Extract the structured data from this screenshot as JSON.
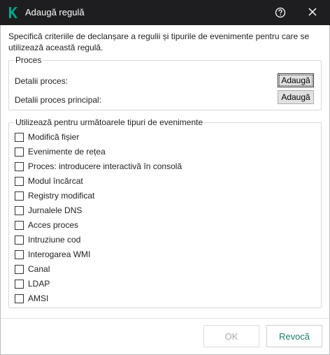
{
  "window": {
    "title": "Adaugă regulă"
  },
  "description": "Specifică criteriile de declanșare a regulii și tipurile de evenimente pentru care se utilizează această regulă.",
  "process_group": {
    "legend": "Proces",
    "rows": [
      {
        "label": "Detalii proces:",
        "button": "Adaugă"
      },
      {
        "label": "Detalii proces principal:",
        "button": "Adaugă"
      }
    ]
  },
  "events_group": {
    "legend": "Utilizează pentru următoarele tipuri de evenimente",
    "items": [
      {
        "label": "Modifică fișier",
        "checked": false
      },
      {
        "label": "Evenimente de rețea",
        "checked": false
      },
      {
        "label": "Proces: introducere interactivă în consolă",
        "checked": false
      },
      {
        "label": "Modul încărcat",
        "checked": false
      },
      {
        "label": "Registry modificat",
        "checked": false
      },
      {
        "label": "Jurnalele DNS",
        "checked": false
      },
      {
        "label": "Acces proces",
        "checked": false
      },
      {
        "label": "Intruziune cod",
        "checked": false
      },
      {
        "label": "Interogarea WMI",
        "checked": false
      },
      {
        "label": "Canal",
        "checked": false
      },
      {
        "label": "LDAP",
        "checked": false
      },
      {
        "label": "AMSI",
        "checked": false
      }
    ]
  },
  "footer": {
    "ok_label": "OK",
    "cancel_label": "Revocă"
  },
  "colors": {
    "titlebar": "#1e1e20",
    "brand": "#00a88e",
    "accent_text": "#1a7e6c",
    "disabled_text": "#a8a8a8"
  },
  "icons": {
    "logo": "kaspersky-k-logo",
    "help": "help-circle-icon",
    "close": "close-icon"
  }
}
